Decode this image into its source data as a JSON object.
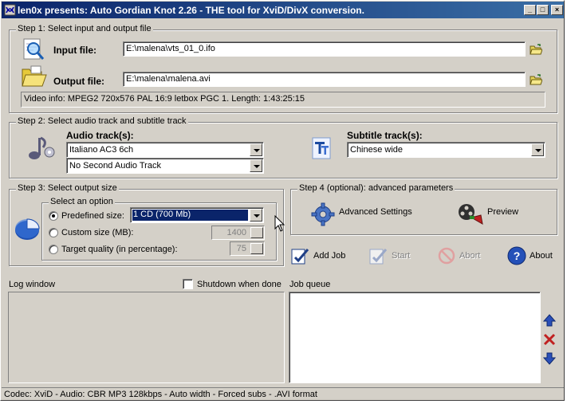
{
  "window": {
    "title": "len0x presents: Auto Gordian Knot 2.26 - THE tool for XviD/DivX conversion.",
    "minimize_glyph": "_",
    "maximize_glyph": "□",
    "close_glyph": "×"
  },
  "step1": {
    "legend": "Step 1: Select input and output file",
    "input_label": "Input file:",
    "input_value": "E:\\malena\\vts_01_0.ifo",
    "output_label": "Output file:",
    "output_value": "E:\\malena\\malena.avi",
    "video_info": "Video info: MPEG2 720x576 PAL 16:9 letbox  PGC 1. Length: 1:43:25:15"
  },
  "step2": {
    "legend": "Step 2: Select audio track and subtitle track",
    "audio_label": "Audio track(s):",
    "audio_track_1": "Italiano AC3 6ch",
    "audio_track_2": "No Second Audio Track",
    "subtitle_label": "Subtitle track(s):",
    "subtitle_value": "Chinese wide"
  },
  "step3": {
    "legend": "Step 3: Select output size",
    "sub_legend": "Select an option",
    "predefined_label": "Predefined size:",
    "predefined_value": "1 CD (700 Mb)",
    "custom_label": "Custom size (MB):",
    "custom_value": "1400",
    "target_label": "Target quality (in percentage):",
    "target_value": "75"
  },
  "step4": {
    "legend": "Step 4 (optional): advanced parameters",
    "advanced_label": "Advanced Settings",
    "preview_label": "Preview"
  },
  "actions": {
    "add_job": "Add Job",
    "start": "Start",
    "abort": "Abort",
    "about": "About"
  },
  "log": {
    "label": "Log window",
    "shutdown_label": "Shutdown when done",
    "queue_label": "Job queue"
  },
  "status": {
    "text": "Codec: XviD -  Audio: CBR MP3 128kbps -  Auto width - Forced subs - .AVI format"
  },
  "colors": {
    "title_gradient_start": "#0a246a",
    "title_gradient_end": "#3a6ea5",
    "dialog_face": "#d4d0c8",
    "selection": "#0a246a"
  }
}
